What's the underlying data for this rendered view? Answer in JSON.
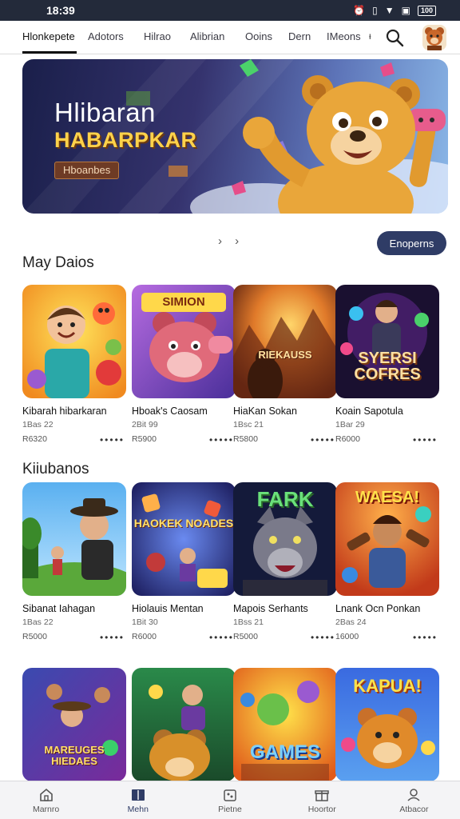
{
  "status": {
    "time": "18:39",
    "icons": [
      "alarm-icon",
      "vibrate-icon",
      "wifi-icon",
      "sim-icon",
      "battery-icon"
    ],
    "battery_label": "100"
  },
  "nav": {
    "tabs": [
      "Hlonkepete",
      "Adotors",
      "Hilrao",
      "Alibrian",
      "Ooins",
      "Dern",
      "IMeons"
    ],
    "more": "ᵻ"
  },
  "banner": {
    "title": "Hlibaran",
    "subtitle": "HABARPKAR",
    "tag": "Hboanbes"
  },
  "carousel": {
    "arrows": "› ›",
    "button_label": "Enoperns"
  },
  "sections": [
    {
      "title": "May Daios",
      "cards": [
        {
          "thumb_text": "",
          "title": "Kibarah hibarkaran",
          "meta": "1Bas 22",
          "price": "R6320",
          "dots": "•••••"
        },
        {
          "thumb_text": "SIMION",
          "title": "Hboak's Caosam",
          "meta": "2Bit 99",
          "price": "R5900",
          "dots": "•••••"
        },
        {
          "thumb_text": "RIEKAUSS",
          "title": "HiaKan Sokan",
          "meta": "1Bsc 21",
          "price": "R5800",
          "dots": "•••••"
        },
        {
          "thumb_text": "SYERSI COFRES",
          "title": "Koain Sapotula",
          "meta": "1Bar 29",
          "price": "R6000",
          "dots": "•••••"
        }
      ]
    },
    {
      "title": "Kiiubanos",
      "cards": [
        {
          "thumb_text": "",
          "title": "Sibanat Iahagan",
          "meta": "1Bas 22",
          "price": "R5000",
          "dots": "•••••"
        },
        {
          "thumb_text": "HAOKEK NOADES",
          "title": "Hiolauis Mentan",
          "meta": "1Bit 30",
          "price": "R6000",
          "dots": "•••••"
        },
        {
          "thumb_text": "FARK",
          "title": "Mapois Serhants",
          "meta": "1Bss 21",
          "price": "R5000",
          "dots": "•••••"
        },
        {
          "thumb_text": "WAESA!",
          "title": "Lnank Ocn Ponkan",
          "meta": "2Bas 24",
          "price": "16000",
          "dots": "•••••"
        }
      ]
    },
    {
      "title": "",
      "cards": [
        {
          "thumb_text": "MAREUGES HIEDAES",
          "title": "",
          "meta": "",
          "price": "",
          "dots": ""
        },
        {
          "thumb_text": "",
          "title": "",
          "meta": "",
          "price": "",
          "dots": ""
        },
        {
          "thumb_text": "GAMES",
          "title": "",
          "meta": "",
          "price": "",
          "dots": ""
        },
        {
          "thumb_text": "KAPUA!",
          "title": "",
          "meta": "",
          "price": "",
          "dots": ""
        }
      ]
    }
  ],
  "bottom_nav": [
    {
      "label": "Marnro",
      "icon": "home-icon"
    },
    {
      "label": "Mehn",
      "icon": "book-icon"
    },
    {
      "label": "Pietne",
      "icon": "puzzle-icon"
    },
    {
      "label": "Hoortor",
      "icon": "gift-icon"
    },
    {
      "label": "Atbacor",
      "icon": "profile-icon"
    }
  ],
  "colors": {
    "accent": "#2f3c66",
    "status_bar": "#232a3a",
    "banner_gold": "#ffd24a"
  }
}
